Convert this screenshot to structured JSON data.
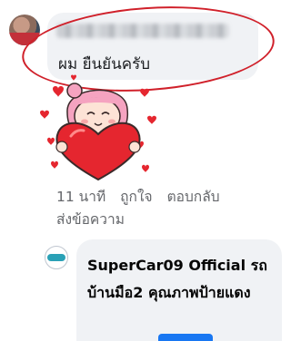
{
  "comment": {
    "message": "ผม ยืนยันครับ",
    "time": "11 นาที",
    "like_label": "ถูกใจ",
    "reply_label": "ตอบกลับ",
    "send_message_label": "ส่งข้อความ"
  },
  "reply": {
    "text": "SuperCar09 Official รถบ้านมือ2 คุณภาพป้ายแดง"
  },
  "colors": {
    "bubble": "#f0f2f5",
    "annotation_ring": "#d0202a",
    "meta_text": "#65676b"
  },
  "icons": {
    "sticker": "girl-holding-heart-sticker",
    "avatar": "user-avatar",
    "page_logo": "supercar09-logo"
  }
}
